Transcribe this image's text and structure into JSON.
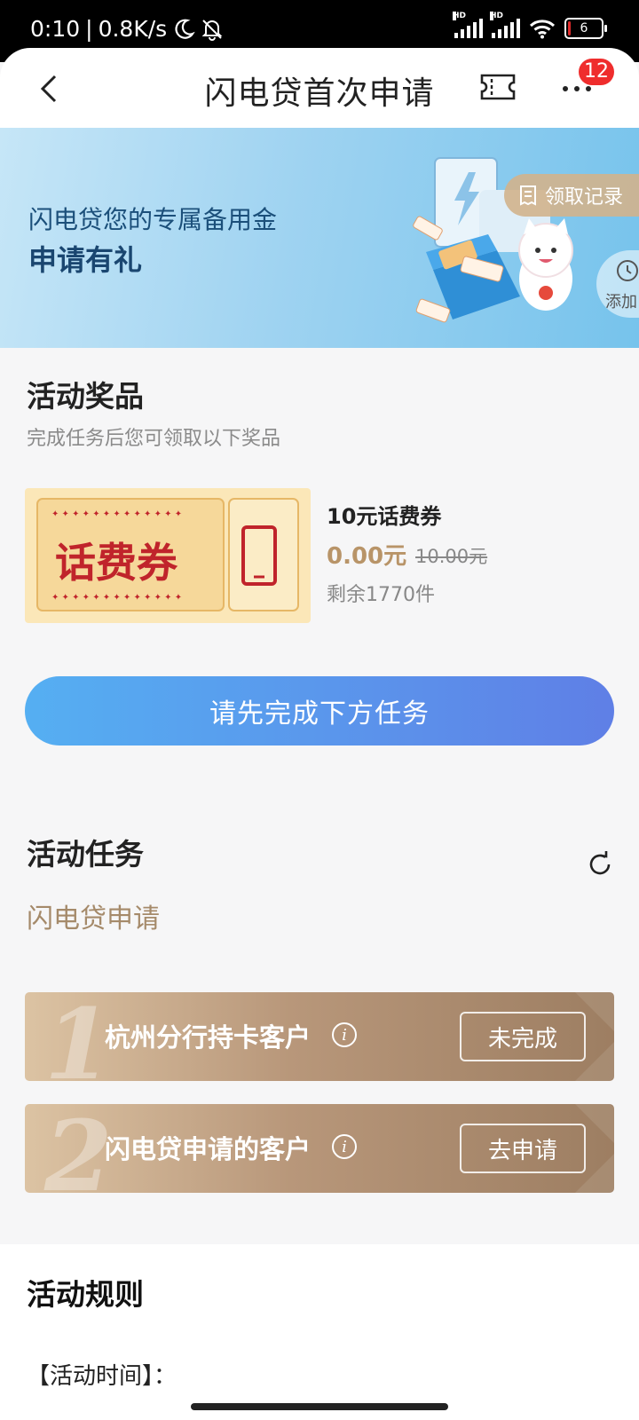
{
  "status_bar": {
    "time": "0:10",
    "speed": "0.8K/s",
    "network1": "HD",
    "network2": "HD",
    "battery": "6",
    "battery_level": 0.06
  },
  "header": {
    "title": "闪电贷首次申请",
    "badge_count": "12"
  },
  "banner": {
    "subtitle": "闪电贷您的专属备用金",
    "headline": "申请有礼",
    "records_label": "领取记录",
    "add_label": "添加"
  },
  "prizes": {
    "title": "活动奖品",
    "subtitle": "完成任务后您可领取以下奖品",
    "coupon_art_text": "话费券",
    "item": {
      "name": "10元话费券",
      "price": "0.00元",
      "original_price": "10.00元",
      "stock": "剩余1770件"
    },
    "cta_label": "请先完成下方任务"
  },
  "tasks": {
    "title": "活动任务",
    "subtitle": "闪电贷申请",
    "items": [
      {
        "number": "1",
        "label": "杭州分行持卡客户",
        "button": "未完成"
      },
      {
        "number": "2",
        "label": "闪电贷申请的客户",
        "button": "去申请"
      }
    ]
  },
  "rules": {
    "title": "活动规则",
    "time_label": "【活动时间】："
  },
  "colors": {
    "accent_gold": "#b89468",
    "cta_start": "#55aff2",
    "cta_end": "#5f7fe6",
    "badge_red": "#ef2d2d"
  }
}
